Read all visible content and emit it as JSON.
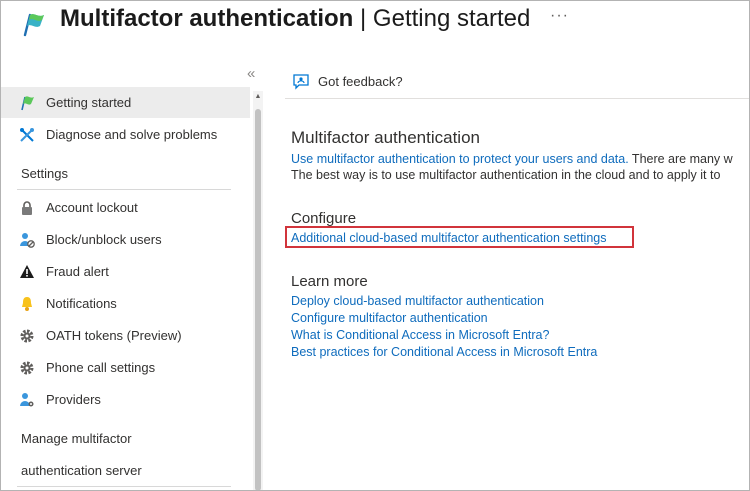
{
  "header": {
    "title_main": "Multifactor authentication",
    "title_separator": " | ",
    "title_sub": "Getting started",
    "more_label": "···",
    "app_icon": "flag-icon"
  },
  "sidebar": {
    "collapse_label": "«",
    "top_items": [
      {
        "label": "Getting started",
        "icon": "flag-icon",
        "selected": true
      },
      {
        "label": "Diagnose and solve problems",
        "icon": "wrench-icon",
        "selected": false
      }
    ],
    "settings_label": "Settings",
    "settings_items": [
      {
        "label": "Account lockout",
        "icon": "lock-icon"
      },
      {
        "label": "Block/unblock users",
        "icon": "block-user-icon"
      },
      {
        "label": "Fraud alert",
        "icon": "warning-icon"
      },
      {
        "label": "Notifications",
        "icon": "bell-icon"
      },
      {
        "label": "OATH tokens (Preview)",
        "icon": "gear-icon"
      },
      {
        "label": "Phone call settings",
        "icon": "gear-icon"
      },
      {
        "label": "Providers",
        "icon": "providers-icon"
      }
    ],
    "server_label_line1": "Manage multifactor",
    "server_label_line2": "authentication server"
  },
  "toolbar": {
    "feedback_label": "Got feedback?",
    "feedback_icon": "feedback-icon"
  },
  "main": {
    "heading": "Multifactor authentication",
    "intro_link": "Use multifactor authentication to protect your users and data.",
    "intro_text_1": " There are many w",
    "intro_text_2": "The best way is to use multifactor authentication in the cloud and to apply it to",
    "configure_heading": "Configure",
    "configure_link": "Additional cloud-based multifactor authentication settings",
    "learn_heading": "Learn more",
    "learn_links": [
      "Deploy cloud-based multifactor authentication",
      "Configure multifactor authentication",
      "What is Conditional Access in Microsoft Entra?",
      "Best practices for Conditional Access in Microsoft Entra"
    ]
  },
  "colors": {
    "link": "#0f6cbd",
    "highlight_border": "#d1343b",
    "selected_bg": "#ececec",
    "brand_green": "#3fb950",
    "brand_blue": "#0078d4"
  }
}
